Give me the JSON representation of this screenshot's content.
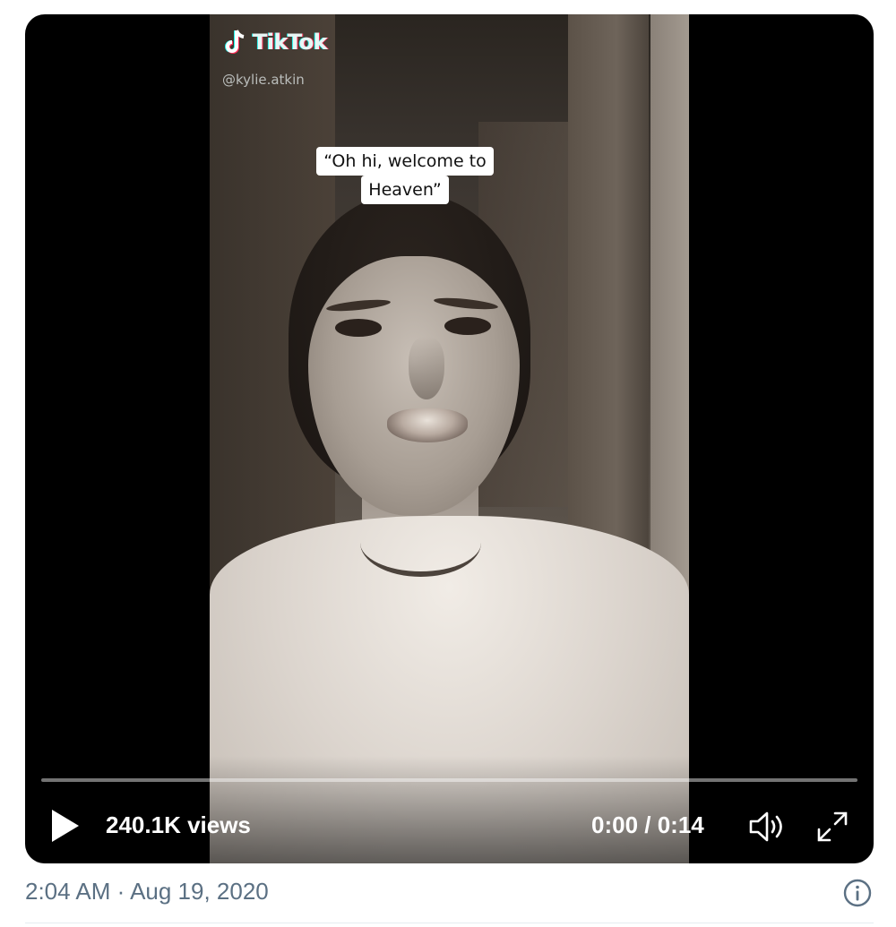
{
  "video": {
    "tiktok_wordmark": "TikTok",
    "tiktok_handle": "@kylie.atkin",
    "caption_line1": "“Oh hi, welcome to",
    "caption_line2": "Heaven”",
    "views_label": "240.1K views",
    "current_time": "0:00",
    "time_separator": " / ",
    "duration": "0:14",
    "progress_fraction": 0,
    "icons": {
      "play": "play-icon",
      "volume": "volume-icon",
      "fullscreen": "fullscreen-icon",
      "info": "info-icon"
    }
  },
  "tweet": {
    "timestamp": "2:04 AM · Aug 19, 2020"
  },
  "colors": {
    "timestamp_text": "#5b7083",
    "media_background": "#000000",
    "control_white": "#ffffff"
  }
}
